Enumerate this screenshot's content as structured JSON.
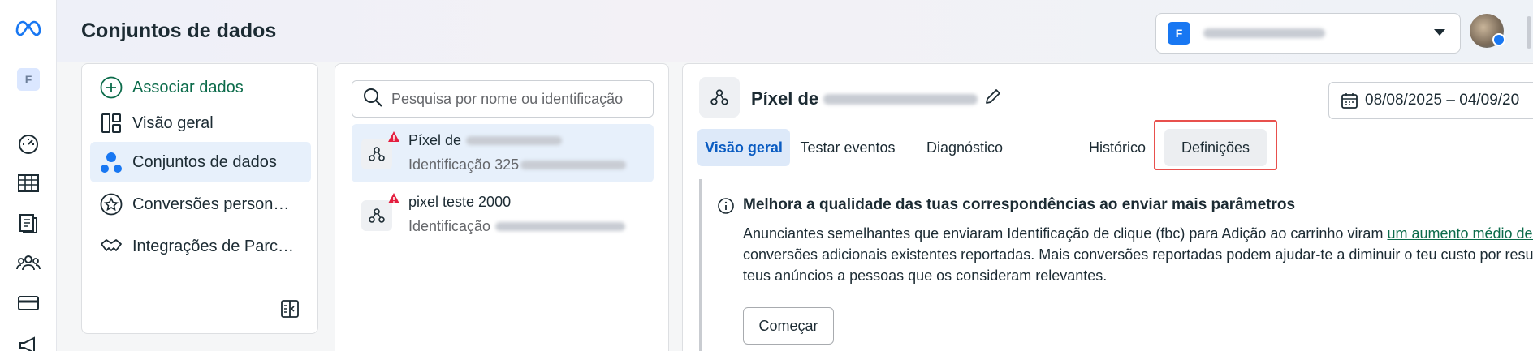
{
  "app": {
    "page_title": "Conjuntos de dados",
    "rail_account_initial": "F"
  },
  "account": {
    "initial": "F"
  },
  "nav": {
    "associate": "Associar dados",
    "overview": "Visão geral",
    "datasets": "Conjuntos de dados",
    "custom_conversions": "Conversões person…",
    "partner_integrations": "Integrações de Parc…"
  },
  "list": {
    "search_placeholder": "Pesquisa por nome ou identificação",
    "items": [
      {
        "title_prefix": "Píxel de",
        "id_prefix": "Identificação 325"
      },
      {
        "title_prefix": "pixel teste 2000",
        "id_prefix": "Identificação"
      }
    ]
  },
  "detail": {
    "title_prefix": "Píxel de",
    "date_range": "08/08/2025 – 04/09/20",
    "tabs": [
      "Visão geral",
      "Testar eventos",
      "Diagnóstico",
      "Histórico",
      "Definições"
    ],
    "banner": {
      "heading": "Melhora a qualidade das tuas correspondências ao enviar mais parâmetros",
      "line1": "Anunciantes semelhantes que enviaram Identificação de clique (fbc) para Adição ao carrinho viram ",
      "line1_link": "um aumento médio de a",
      "line2": "conversões adicionais existentes reportadas. Mais conversões reportadas podem ajudar-te a diminuir o teu custo por resul",
      "line3": "teus anúncios a pessoas que os consideram relevantes.",
      "button": "Começar"
    }
  },
  "colors": {
    "accent": "#1877f2",
    "active_tab": "#0a5cc2",
    "link_green": "#0b6b4a",
    "highlight_red": "#e8504d"
  }
}
